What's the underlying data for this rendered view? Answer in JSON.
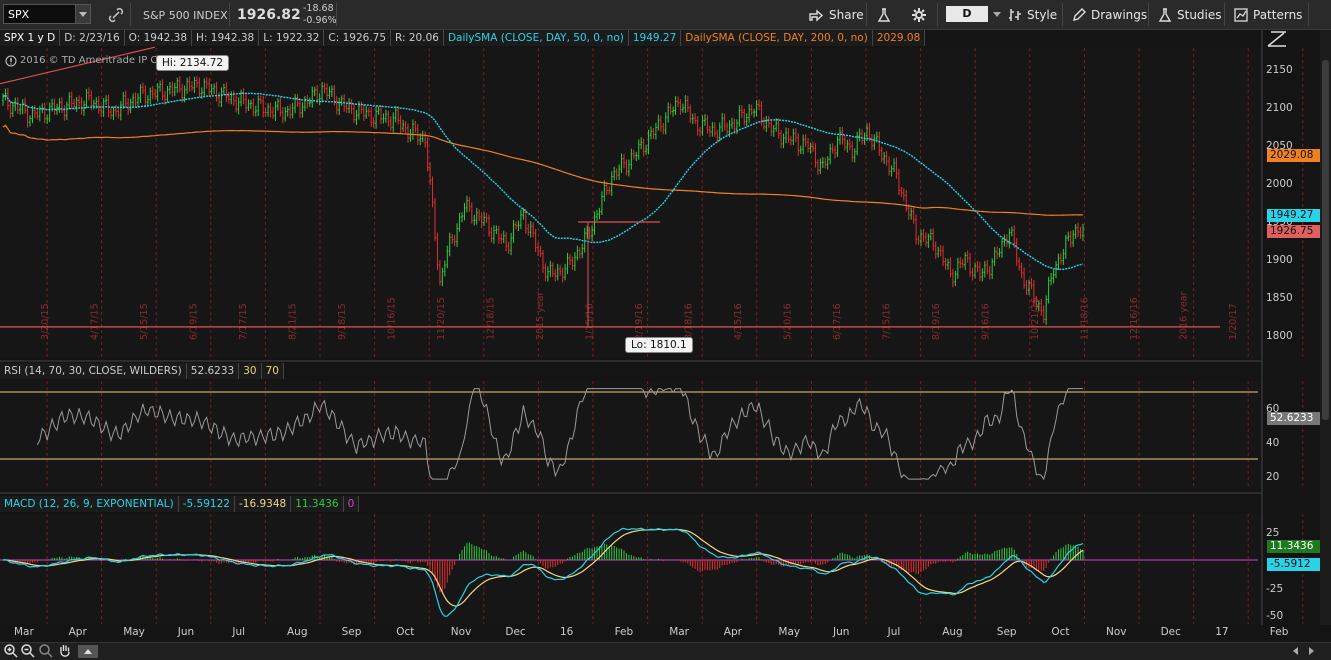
{
  "toolbar": {
    "symbol": "SPX",
    "description": "S&P 500 INDEX",
    "last_price": "1926.82",
    "net_change": "-18.68",
    "pct_change": "-0.96%",
    "share_label": "Share",
    "aggregation": "D",
    "style_label": "Style",
    "drawings_label": "Drawings",
    "studies_label": "Studies",
    "patterns_label": "Patterns"
  },
  "price_legend": {
    "title": "SPX 1 y D",
    "date": "D: 2/23/16",
    "open": "O: 1942.38",
    "high": "H: 1942.38",
    "low": "L: 1922.32",
    "close": "C: 1926.75",
    "range": "R: 20.06",
    "sma50_label": "DailySMA (CLOSE, DAY, 50, 0, no)",
    "sma50_value": "1949.27",
    "sma200_label": "DailySMA (CLOSE, DAY, 200, 0, no)",
    "sma200_value": "2029.08"
  },
  "copyright": "2016 © TD Ameritrade IP Co",
  "hi_callout": "Hi: 2134.72",
  "lo_callout": "Lo: 1810.1",
  "price_axis": [
    "2150",
    "2100",
    "2050",
    "2000",
    "1950",
    "1900",
    "1850",
    "1800"
  ],
  "price_tags": {
    "sma200": "2029.08",
    "sma50": "1949.27",
    "last": "1926.75"
  },
  "vertical_date_labels": [
    "3/20/15",
    "4/17/15",
    "5/15/15",
    "6/19/15",
    "7/17/15",
    "8/21/15",
    "9/18/15",
    "10/16/15",
    "11/20/15",
    "12/18/15",
    "2015 year",
    "1/15/16",
    "2/19/16",
    "3/18/16",
    "4/15/16",
    "5/20/16",
    "6/17/16",
    "7/15/16",
    "8/19/16",
    "9/16/16",
    "10/21/16",
    "11/18/16",
    "12/16/16",
    "2016 year",
    "1/20/17"
  ],
  "rsi": {
    "label": "RSI (14, 70, 30, CLOSE, WILDERS)",
    "value": "52.6233",
    "oversold": "30",
    "overbought": "70",
    "axis": [
      "60",
      "40",
      "20"
    ]
  },
  "macd": {
    "label": "MACD (12, 26, 9, EXPONENTIAL)",
    "value": "-5.59122",
    "avg": "-16.9348",
    "diff": "11.3436",
    "zero": "0",
    "axis": [
      "25",
      "-25",
      "-50"
    ],
    "tag_diff": "11.3436",
    "tag_value": "-5.5912"
  },
  "months": [
    "Mar",
    "Apr",
    "May",
    "Jun",
    "Jul",
    "Aug",
    "Sep",
    "Oct",
    "Nov",
    "Dec",
    "16",
    "Feb",
    "Mar",
    "Apr",
    "May",
    "Jun",
    "Jul",
    "Aug",
    "Sep",
    "Oct",
    "Nov",
    "Dec",
    "17",
    "Feb"
  ],
  "colors": {
    "up": "#2ecc40",
    "down": "#e03030",
    "sma50": "#29d3e8",
    "sma200": "#f08020",
    "grid": "#7a1e1e",
    "hline": "#e05050"
  }
}
